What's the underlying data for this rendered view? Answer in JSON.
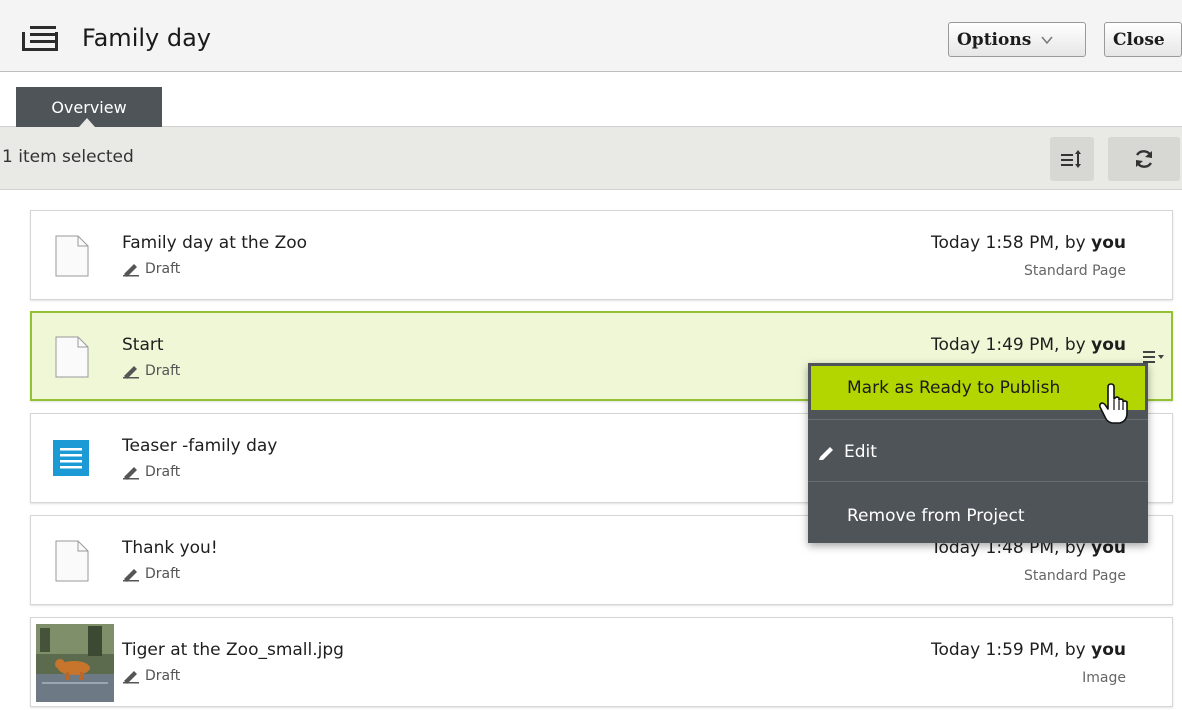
{
  "header": {
    "title": "Family day",
    "options_label": "Options",
    "close_label": "Close",
    "icon": "list-icon"
  },
  "tabs": [
    {
      "label": "Overview",
      "active": true
    }
  ],
  "selection_bar": {
    "text": "1 item selected",
    "sort_icon": "sort-icon",
    "refresh_icon": "refresh-icon"
  },
  "items": [
    {
      "name": "Family day at the Zoo",
      "status": "Draft",
      "time": "Today 1:58 PM, by ",
      "user": "you",
      "type": "Standard Page",
      "icon": "page-icon"
    },
    {
      "name": "Start",
      "status": "Draft",
      "time": "Today 1:49 PM, by ",
      "user": "you",
      "type": "",
      "icon": "page-icon",
      "selected": true
    },
    {
      "name": "Teaser -family day",
      "status": "Draft",
      "time": "",
      "user": "",
      "type": "",
      "icon": "block-icon"
    },
    {
      "name": "Thank you!",
      "status": "Draft",
      "time": "Today 1:48 PM, by ",
      "user": "you",
      "type": "Standard Page",
      "icon": "page-icon"
    },
    {
      "name": "Tiger at the Zoo_small.jpg",
      "status": "Draft",
      "time": "Today 1:59 PM, by ",
      "user": "you",
      "type": "Image",
      "icon": "image-thumbnail"
    }
  ],
  "context_menu": {
    "items": [
      {
        "label": "Mark as Ready to Publish",
        "highlighted": true
      },
      {
        "label": "Edit",
        "icon": "pencil-icon"
      },
      {
        "label": "Remove from Project"
      }
    ]
  },
  "colors": {
    "accent_green": "#b3d500",
    "selected_border": "#93c131",
    "dark_panel": "#4f5459",
    "block_blue": "#1b9ad6"
  }
}
